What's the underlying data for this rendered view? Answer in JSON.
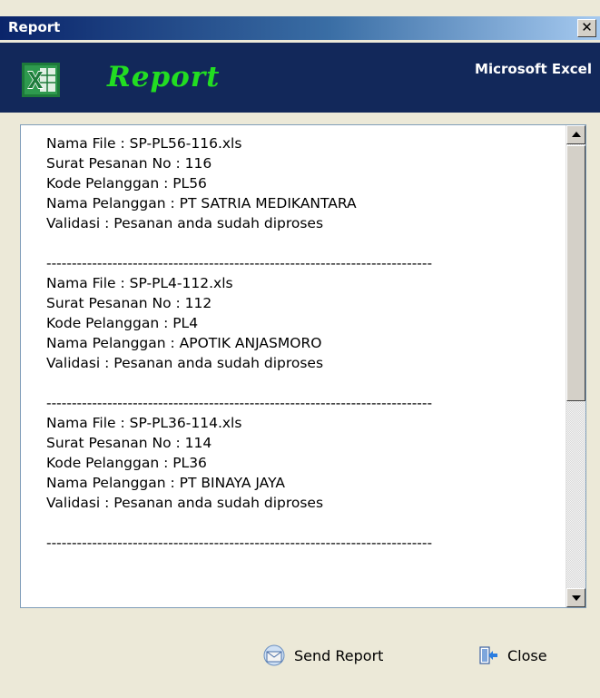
{
  "window": {
    "title": "Report"
  },
  "banner": {
    "title": "Report",
    "product": "Microsoft Excel",
    "icon": "excel-icon"
  },
  "records": [
    {
      "lines": [
        "Nama File : SP-PL56-116.xls",
        "Surat Pesanan No : 116",
        "Kode Pelanggan : PL56",
        "Nama Pelanggan : PT SATRIA MEDIKANTARA",
        "Validasi : Pesanan anda sudah diproses"
      ]
    },
    {
      "lines": [
        "Nama File : SP-PL4-112.xls",
        "Surat Pesanan No : 112",
        "Kode Pelanggan : PL4",
        "Nama Pelanggan : APOTIK ANJASMORO",
        "Validasi : Pesanan anda sudah diproses"
      ]
    },
    {
      "lines": [
        "Nama File : SP-PL36-114.xls",
        "Surat Pesanan No : 114",
        "Kode Pelanggan : PL36",
        "Nama Pelanggan : PT BINAYA JAYA",
        "Validasi : Pesanan anda sudah diproses"
      ]
    }
  ],
  "separator": "----------------------------------------------------------------------------",
  "buttons": {
    "send_label": "Send Report",
    "close_label": "Close"
  },
  "colors": {
    "banner_bg": "#12285a",
    "banner_title": "#22dd22",
    "excel_green": "#1d7a3a"
  }
}
